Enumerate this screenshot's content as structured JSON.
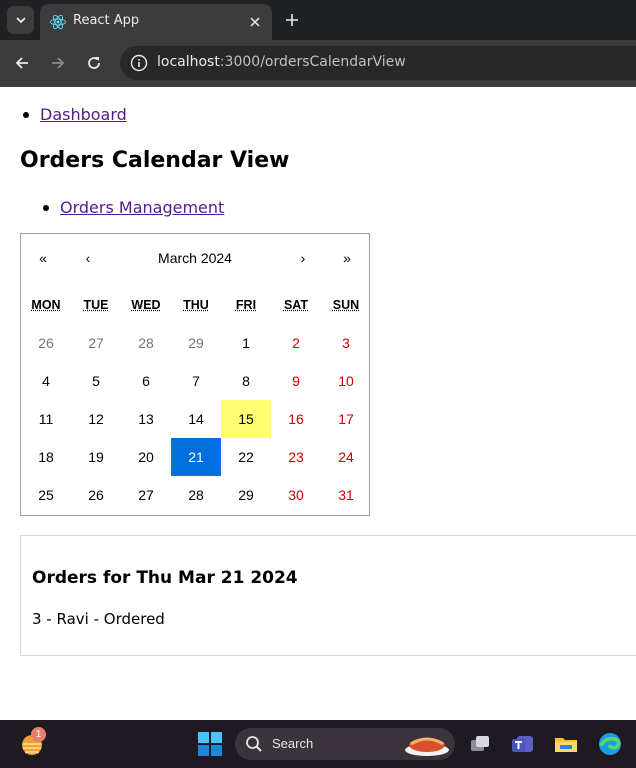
{
  "browser": {
    "tab_title": "React App",
    "url_host": "localhost",
    "url_path": ":3000/ordersCalendarView"
  },
  "nav": {
    "dashboard_link": "Dashboard",
    "orders_management_link": "Orders Management"
  },
  "page": {
    "title": "Orders Calendar View"
  },
  "calendar": {
    "prev2": "«",
    "prev": "‹",
    "label": "March 2024",
    "next": "›",
    "next2": "»",
    "weekdays": [
      "MON",
      "TUE",
      "WED",
      "THU",
      "FRI",
      "SAT",
      "SUN"
    ],
    "weeks": [
      [
        "26",
        "27",
        "28",
        "29",
        "1",
        "2",
        "3"
      ],
      [
        "4",
        "5",
        "6",
        "7",
        "8",
        "9",
        "10"
      ],
      [
        "11",
        "12",
        "13",
        "14",
        "15",
        "16",
        "17"
      ],
      [
        "18",
        "19",
        "20",
        "21",
        "22",
        "23",
        "24"
      ],
      [
        "25",
        "26",
        "27",
        "28",
        "29",
        "30",
        "31"
      ]
    ],
    "today": "15",
    "selected": "21",
    "colors": {
      "weekend": "#d10000",
      "neighbor": "#757575",
      "today_bg": "#ffff76",
      "selected_bg": "#006edc"
    }
  },
  "orders": {
    "title": "Orders for Thu Mar 21 2024",
    "items": [
      "3 - Ravi - Ordered"
    ]
  },
  "taskbar": {
    "search_placeholder": "Search",
    "widget_badge": "1"
  }
}
